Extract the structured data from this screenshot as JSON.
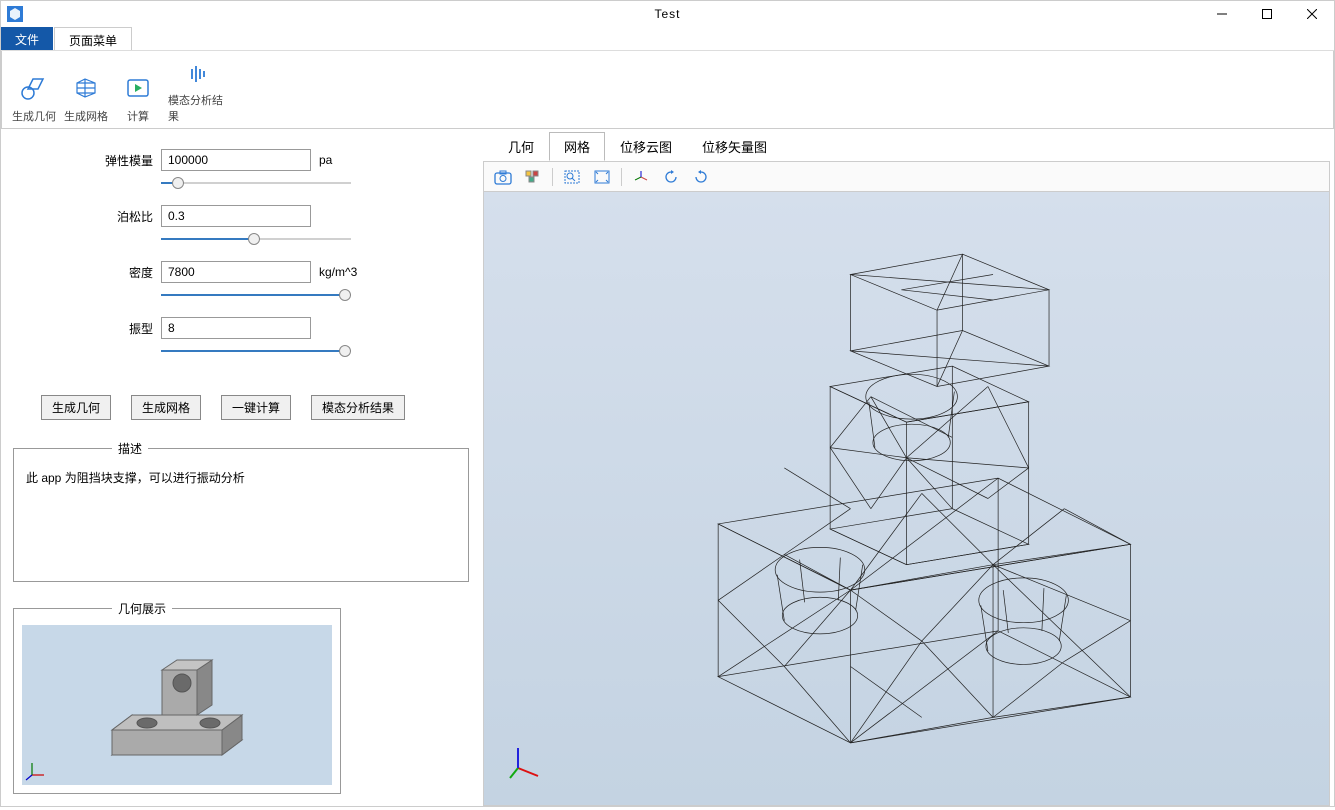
{
  "window": {
    "title": "Test"
  },
  "menu": {
    "file": "文件",
    "page": "页面菜单"
  },
  "ribbon": {
    "gen_geom": "生成几何",
    "gen_mesh": "生成网格",
    "compute": "计算",
    "modal_result": "模态分析结果"
  },
  "params": {
    "elastic_label": "弹性模量",
    "elastic_value": "100000",
    "elastic_unit": "pa",
    "elastic_slider": 9,
    "poisson_label": "泊松比",
    "poisson_value": "0.3",
    "poisson_slider": 49,
    "density_label": "密度",
    "density_value": "7800",
    "density_unit": "kg/m^3",
    "density_slider": 97,
    "mode_label": "振型",
    "mode_value": "8",
    "mode_slider": 97
  },
  "buttons": {
    "gen_geom": "生成几何",
    "gen_mesh": "生成网格",
    "compute_all": "一键计算",
    "modal_result": "模态分析结果"
  },
  "desc": {
    "legend": "描述",
    "text": "此 app 为阻挡块支撑，可以进行振动分析"
  },
  "preview": {
    "legend": "几何展示"
  },
  "view_tabs": {
    "geom": "几何",
    "mesh": "网格",
    "disp_cloud": "位移云图",
    "disp_vector": "位移矢量图",
    "active": "mesh"
  }
}
